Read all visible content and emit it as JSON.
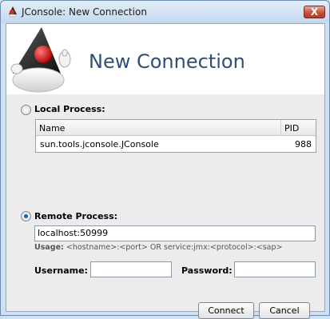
{
  "window": {
    "title": "JConsole: New Connection",
    "close_label": "X"
  },
  "banner": {
    "title": "New Connection"
  },
  "local": {
    "label": "Local Process:",
    "columns": [
      "Name",
      "PID"
    ],
    "rows": [
      {
        "name": "sun.tools.jconsole.JConsole",
        "pid": "988"
      }
    ]
  },
  "remote": {
    "label": "Remote Process:",
    "value": "localhost:50999",
    "usage_prefix": "Usage:",
    "usage_text": "<hostname>:<port> OR service:jmx:<protocol>:<sap>"
  },
  "credentials": {
    "username_label": "Username:",
    "username_value": "",
    "password_label": "Password:",
    "password_value": ""
  },
  "buttons": {
    "connect": "Connect",
    "cancel": "Cancel"
  }
}
